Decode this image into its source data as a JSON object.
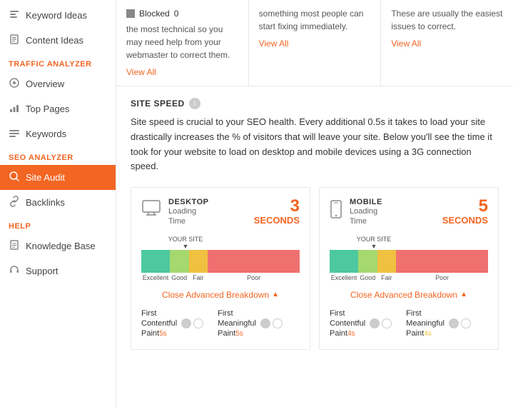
{
  "sidebar": {
    "sections": [
      {
        "items": [
          {
            "id": "keyword-ideas",
            "label": "Keyword Ideas",
            "icon": "🔑",
            "active": false
          },
          {
            "id": "content-ideas",
            "label": "Content Ideas",
            "icon": "📄",
            "active": false
          }
        ]
      },
      {
        "label": "TRAFFIC ANALYZER",
        "items": [
          {
            "id": "overview",
            "label": "Overview",
            "icon": "👁",
            "active": false
          },
          {
            "id": "top-pages",
            "label": "Top Pages",
            "icon": "📊",
            "active": false
          },
          {
            "id": "keywords",
            "label": "Keywords",
            "icon": "🔤",
            "active": false
          }
        ]
      },
      {
        "label": "SEO ANALYZER",
        "items": [
          {
            "id": "site-audit",
            "label": "Site Audit",
            "icon": "🔍",
            "active": true
          },
          {
            "id": "backlinks",
            "label": "Backlinks",
            "icon": "🔗",
            "active": false
          }
        ]
      },
      {
        "label": "HELP",
        "items": [
          {
            "id": "knowledge-base",
            "label": "Knowledge Base",
            "icon": "📖",
            "active": false
          },
          {
            "id": "support",
            "label": "Support",
            "icon": "🎧",
            "active": false
          }
        ]
      }
    ]
  },
  "top_cards": [
    {
      "blocked_label": "Blocked",
      "blocked_count": "0",
      "description": "the most technical so you may need help from your webmaster to correct them.",
      "view_all": "View All"
    },
    {
      "description": "something most people can start fixing immediately.",
      "view_all": "View All"
    },
    {
      "description": "These are usually the easiest issues to correct.",
      "view_all": "View All"
    }
  ],
  "site_speed": {
    "title": "SITE SPEED",
    "description": "Site speed is crucial to your SEO health. Every additional 0.5s it takes to load your site drastically increases the % of visitors that will leave your site. Below you'll see the time it took for your website to load on desktop and mobile devices using a 3G connection speed.",
    "desktop": {
      "type": "DESKTOP",
      "loading_label": "Loading",
      "time_label": "Time",
      "seconds_value": "3",
      "seconds_unit": "SECONDS",
      "your_site_label": "YOUR SITE",
      "bar_segments": [
        {
          "label": "Excellent",
          "width": 18,
          "class": "bar-excellent"
        },
        {
          "label": "Good",
          "width": 12,
          "class": "bar-good"
        },
        {
          "label": "Fair",
          "width": 12,
          "class": "bar-fair"
        },
        {
          "label": "Poor",
          "width": 58,
          "class": "bar-poor"
        }
      ],
      "close_label": "Close Advanced Breakdown",
      "metrics": [
        {
          "label": "First\nContentful\nPaint",
          "value": "5s"
        },
        {
          "label": "First\nMeaningful\nPaint",
          "value": "5s"
        }
      ]
    },
    "mobile": {
      "type": "MOBILE",
      "loading_label": "Loading",
      "time_label": "Time",
      "seconds_value": "5",
      "seconds_unit": "SECONDS",
      "your_site_label": "YOUR SITE",
      "bar_segments": [
        {
          "label": "Excellent",
          "width": 18,
          "class": "bar-excellent"
        },
        {
          "label": "Good",
          "width": 12,
          "class": "bar-good"
        },
        {
          "label": "Fair",
          "width": 12,
          "class": "bar-fair"
        },
        {
          "label": "Poor",
          "width": 58,
          "class": "bar-poor"
        }
      ],
      "close_label": "Close Advanced Breakdown",
      "metrics": [
        {
          "label": "First\nContentful\nPaint",
          "value": "4s"
        },
        {
          "label": "First\nMeaningful\nPaint",
          "value": "4s"
        }
      ]
    }
  }
}
